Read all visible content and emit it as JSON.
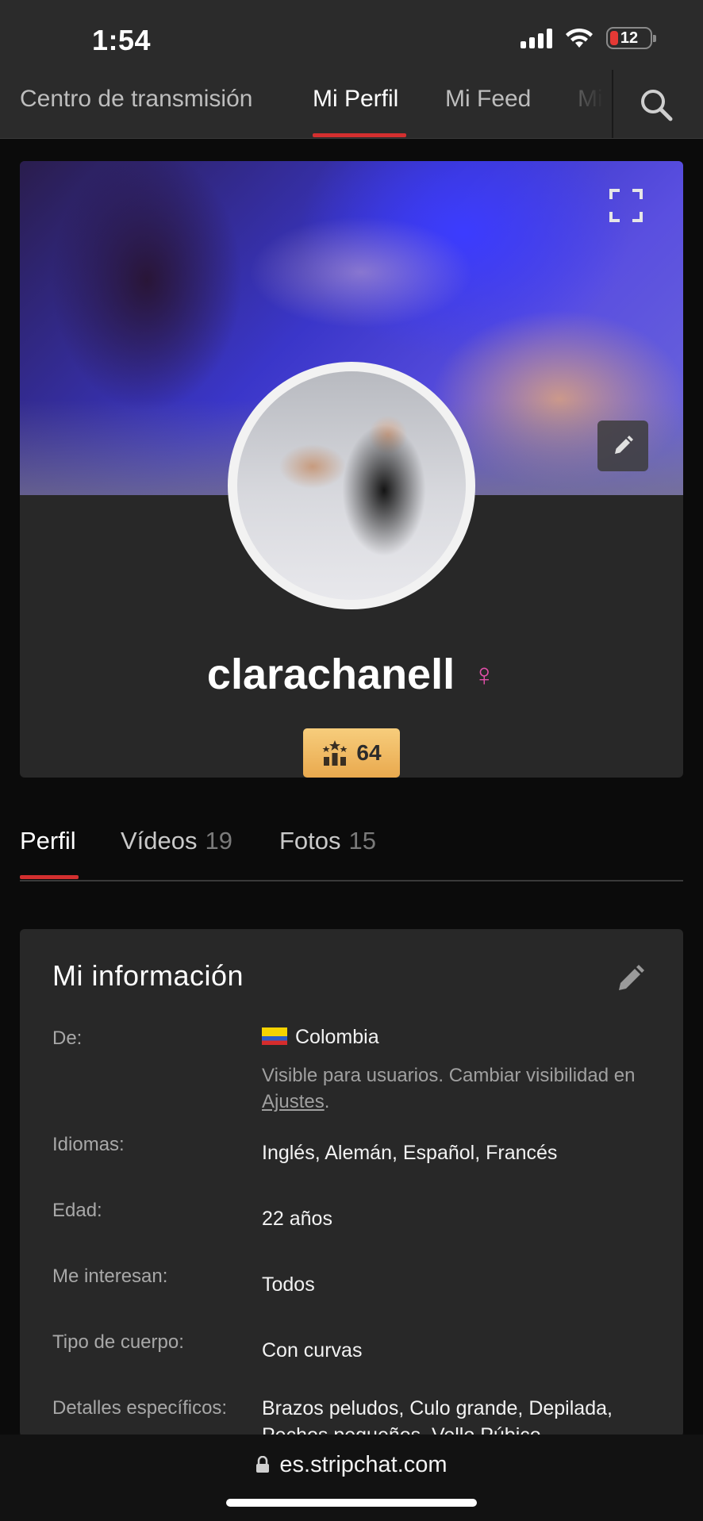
{
  "status": {
    "time": "1:54",
    "battery": "12"
  },
  "topnav": {
    "tabs": [
      "Centro de transmisión",
      "Mi Perfil",
      "Mi Feed",
      "Mi"
    ],
    "active": "Mi Perfil"
  },
  "profile": {
    "username": "clarachanell",
    "gender_symbol": "♀",
    "level": "64"
  },
  "profile_tabs": [
    {
      "label": "Perfil",
      "count": ""
    },
    {
      "label": "Vídeos",
      "count": "19"
    },
    {
      "label": "Fotos",
      "count": "15"
    }
  ],
  "info": {
    "title": "Mi información",
    "from_label": "De:",
    "from_value": "Colombia",
    "visibility_note": "Visible para usuarios. Cambiar visibilidad en",
    "visibility_link": "Ajustes",
    "languages_label": "Idiomas:",
    "languages_value": "Inglés, Alemán, Español, Francés",
    "age_label": "Edad:",
    "age_value": "22 años",
    "interest_label": "Me interesan:",
    "interest_value": "Todos",
    "body_label": "Tipo de cuerpo:",
    "body_value": "Con curvas",
    "details_label": "Detalles específicos:",
    "details_value_line1": "Brazos peludos, Culo grande, Depilada,",
    "details_value_line2": "Pechos pequeños, Vello Púbico"
  },
  "browser": {
    "url": "es.stripchat.com"
  },
  "colors": {
    "accent": "#d32f2f",
    "badge": "#f0b862",
    "gender": "#e04fa8"
  }
}
